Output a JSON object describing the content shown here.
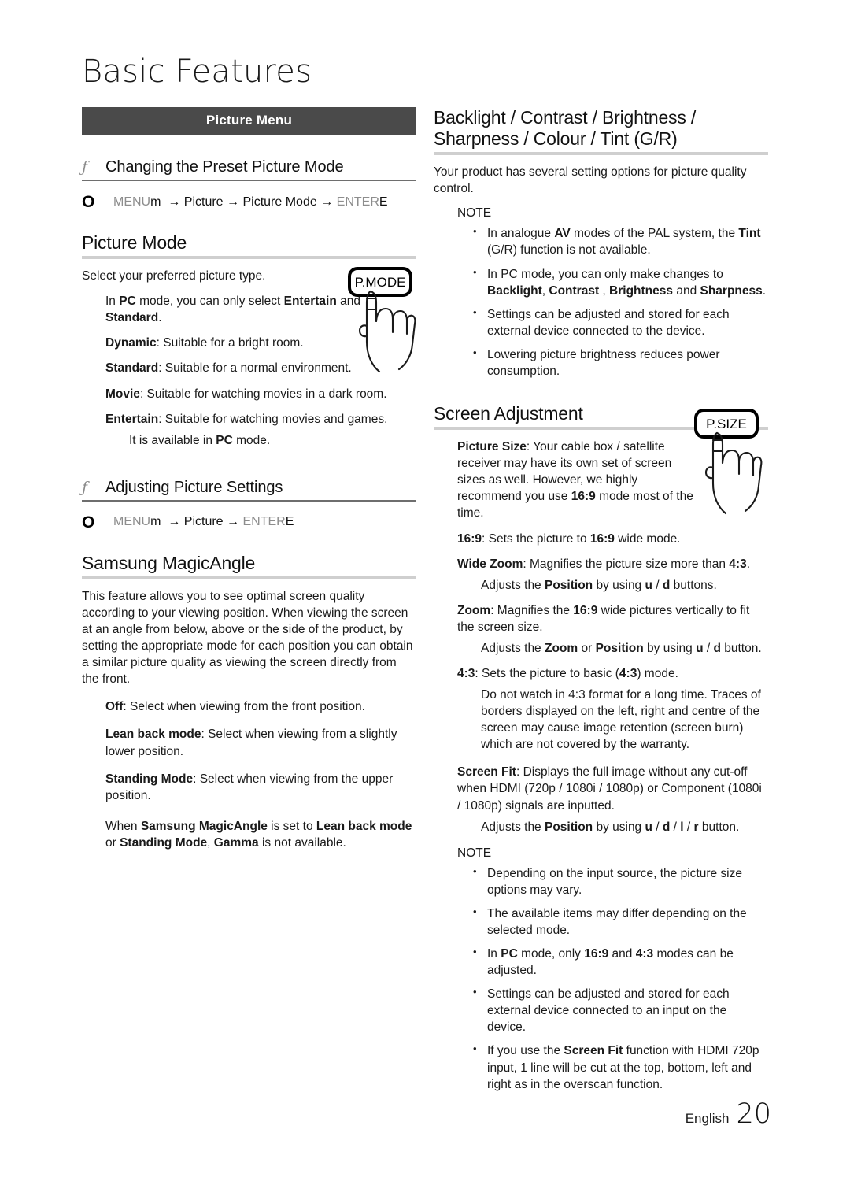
{
  "page": {
    "title": "Basic Features",
    "footer_language": "English",
    "footer_page_number": "20"
  },
  "colors": {
    "menu_bar_bg": "#4a4a4a",
    "menu_bar_text": "#ffffff",
    "heading_rule": "#cfcfcf",
    "gray_text": "#8d8d8d"
  },
  "left_column": {
    "menu_bar_label": "Picture Menu",
    "f_heading_1": {
      "marker": "ƒ",
      "text": "Changing the Preset Picture Mode"
    },
    "menu_path_1": {
      "marker": "O",
      "menu_word": "MENU",
      "menu_glyph": "m",
      "arrow": "→",
      "step_1": "Picture",
      "step_2": "Picture Mode",
      "enter_word": "ENTER",
      "enter_glyph": "E"
    },
    "picture_mode": {
      "heading": "Picture Mode",
      "intro": "Select your preferred picture type.",
      "note_pc": {
        "pre": "In ",
        "bold_1": "PC",
        "mid": " mode, you can only select ",
        "bold_2": "Entertain",
        "mid_2": " and ",
        "bold_3": "Standard",
        "post": "."
      },
      "items": [
        {
          "term": "Dynamic",
          "desc": ": Suitable for a bright room."
        },
        {
          "term": "Standard",
          "desc": ": Suitable for a normal environment."
        },
        {
          "term": "Movie",
          "desc": ": Suitable for watching movies in a dark room."
        },
        {
          "term": "Entertain",
          "desc": ": Suitable for watching movies and games."
        }
      ],
      "pc_availability": {
        "pre": "It is available in ",
        "bold": "PC",
        "post": " mode."
      },
      "remote_key_label": "P.MODE"
    },
    "f_heading_2": {
      "marker": "ƒ",
      "text": "Adjusting Picture Settings"
    },
    "menu_path_2": {
      "marker": "O",
      "menu_word": "MENU",
      "menu_glyph": "m",
      "arrow": "→",
      "step_1": "Picture",
      "enter_word": "ENTER",
      "enter_glyph": "E"
    },
    "magic_angle": {
      "heading": "Samsung MagicAngle",
      "intro": "This feature allows you to see optimal screen quality according to your viewing position. When viewing the screen at an angle from below, above or the side of the product, by setting the appropriate mode for each position you can obtain a similar picture quality as viewing the screen directly from the front.",
      "items": [
        {
          "term": "Off",
          "desc": ": Select when viewing from the front position."
        },
        {
          "term": "Lean back mode",
          "desc": ": Select when viewing from a slightly lower position."
        },
        {
          "term": "Standing Mode",
          "desc": ": Select when viewing from the upper position."
        }
      ],
      "gamma_note": {
        "pre": "When ",
        "bold_1": "Samsung MagicAngle",
        "mid_1": " is set to ",
        "bold_2": "Lean back mode",
        "mid_2": " or ",
        "bold_3": "Standing Mode",
        "mid_3": ", ",
        "bold_4": "Gamma",
        "post": " is not available."
      }
    }
  },
  "right_column": {
    "backlight_section": {
      "heading_line_1": "Backlight / Contrast / Brightness /",
      "heading_line_2": "Sharpness / Colour / Tint (G/R)",
      "intro": "Your product has several setting options for picture quality control.",
      "note_label": "NOTE",
      "notes": [
        {
          "pre": "In analogue ",
          "bold_1": "AV",
          "mid_1": " modes of the PAL system, the ",
          "bold_2": "Tint",
          "post": " (G/R) function is not available."
        },
        {
          "pre": "In PC mode, you can only make changes to ",
          "bold_1": "Backlight",
          "mid_1": ", ",
          "bold_2": "Contrast",
          "mid_2": " , ",
          "bold_3": "Brightness",
          "mid_3": " and ",
          "bold_4": "Sharpness",
          "post": "."
        },
        {
          "plain": "Settings can be adjusted and stored for each external device connected to the device."
        },
        {
          "plain": "Lowering picture brightness reduces power consumption."
        }
      ]
    },
    "screen_adjustment": {
      "heading": "Screen Adjustment",
      "remote_key_label": "P.SIZE",
      "picture_size": {
        "term": "Picture Size",
        "desc_pre": ": Your cable box / satellite receiver may have its own set of screen sizes as well. However, we highly recommend you use ",
        "bold": "16:9",
        "desc_post": " mode most of the time."
      },
      "modes": [
        {
          "term": "16:9",
          "desc_pre": ": Sets the picture to ",
          "bold": "16:9",
          "desc_post": " wide mode.",
          "sub": null
        },
        {
          "term": "Wide Zoom",
          "desc_pre": ": Magnifies the picture size more than ",
          "bold": "4:3",
          "desc_post": ".",
          "sub": {
            "pre": "Adjusts the ",
            "bold_1": "Position",
            "mid": " by using ",
            "key_1": "u",
            "sep": " / ",
            "key_2": "d",
            "post": " buttons."
          }
        },
        {
          "term": "Zoom",
          "desc_pre": ": Magnifies the ",
          "bold": "16:9",
          "desc_post": " wide pictures vertically to fit the screen size.",
          "sub": {
            "pre": "Adjusts the ",
            "bold_1": "Zoom",
            "mid_0": " or ",
            "bold_2": "Position",
            "mid": " by using ",
            "key_1": "u",
            "sep": " / ",
            "key_2": "d",
            "post": " button."
          }
        },
        {
          "term": "4:3",
          "desc_pre": ": Sets the picture to basic (",
          "bold": "4:3",
          "desc_post": ") mode.",
          "sub_plain": "Do not watch in 4:3 format for a long time. Traces of borders displayed on the left, right and centre of the screen may cause image retention (screen burn) which are not covered by the warranty."
        },
        {
          "term": "Screen Fit",
          "desc_plain": ": Displays the full image without any cut-off when HDMI (720p / 1080i / 1080p) or Component (1080i / 1080p) signals are inputted.",
          "sub": {
            "pre": "Adjusts the ",
            "bold_1": "Position",
            "mid": " by using ",
            "key_1": "u",
            "sep": " / ",
            "key_2": "d",
            "key_3": "l",
            "key_4": "r",
            "post": " button."
          }
        }
      ],
      "note_label": "NOTE",
      "notes": [
        {
          "plain": "Depending on the input source, the picture size options may vary."
        },
        {
          "plain": "The available items may differ depending on the selected mode."
        },
        {
          "pre": "In ",
          "bold_1": "PC",
          "mid_1": " mode, only ",
          "bold_2": "16:9",
          "mid_2": " and ",
          "bold_3": "4:3",
          "post": " modes can be adjusted."
        },
        {
          "plain": "Settings can be adjusted and stored for each external device connected to an input on the device."
        },
        {
          "pre": "If you use the ",
          "bold_1": "Screen Fit",
          "post": " function with HDMI 720p input, 1 line will be cut at the top, bottom, left and right as in the overscan function."
        }
      ]
    }
  }
}
